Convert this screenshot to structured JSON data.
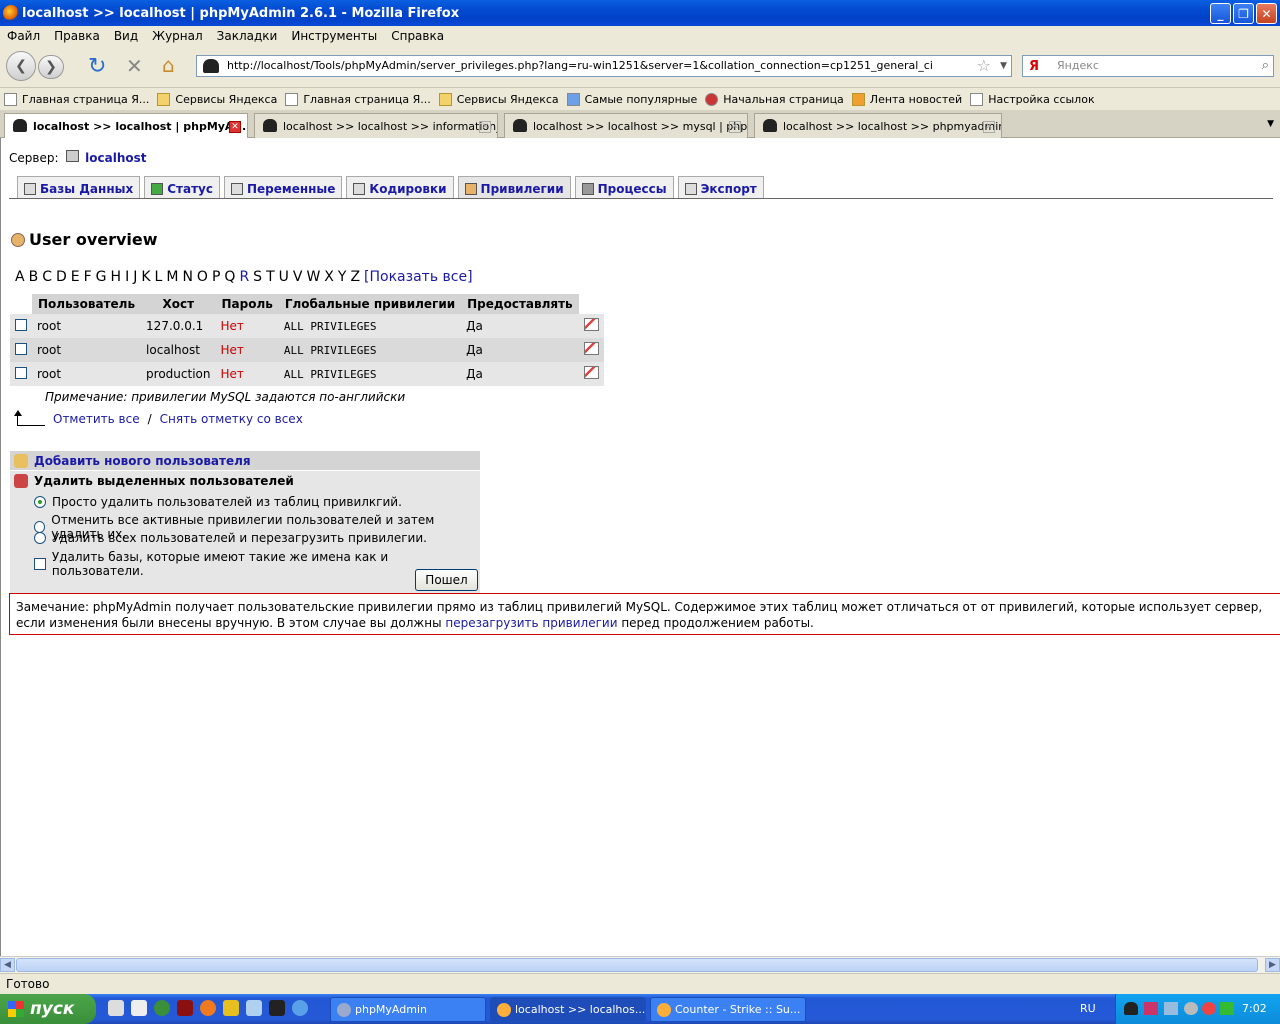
{
  "window": {
    "title": "localhost >> localhost | phpMyAdmin 2.6.1 - Mozilla Firefox"
  },
  "menu": [
    "Файл",
    "Правка",
    "Вид",
    "Журнал",
    "Закладки",
    "Инструменты",
    "Справка"
  ],
  "url": "http://localhost/Tools/phpMyAdmin/server_privileges.php?lang=ru-win1251&server=1&collation_connection=cp1251_general_ci",
  "search_placeholder": "Яндекс",
  "bookmarks": [
    "Главная страница Я...",
    "Сервисы Яндекса",
    "Главная страница Я...",
    "Сервисы Яндекса",
    "Самые популярные",
    "Начальная страница",
    "Лента новостей",
    "Настройка ссылок"
  ],
  "tabs": [
    "localhost >> localhost | phpMyA...",
    "localhost >> localhost >> information_...",
    "localhost >> localhost >> mysql | php...",
    "localhost >> localhost >> phpmyadmin..."
  ],
  "server": {
    "label": "Сервер:",
    "name": "localhost"
  },
  "page_tabs": [
    "Базы Данных",
    "Статус",
    "Переменные",
    "Кодировки",
    "Привилегии",
    "Процессы",
    "Экспорт"
  ],
  "heading": "User overview",
  "letters": [
    "A",
    "B",
    "C",
    "D",
    "E",
    "F",
    "G",
    "H",
    "I",
    "J",
    "K",
    "L",
    "M",
    "N",
    "O",
    "P",
    "Q",
    "R",
    "S",
    "T",
    "U",
    "V",
    "W",
    "X",
    "Y",
    "Z"
  ],
  "show_all": "[Показать все]",
  "table": {
    "headers": [
      "Пользователь",
      "Хост",
      "Пароль",
      "Глобальные привилегии",
      "Предоставлять"
    ],
    "rows": [
      {
        "user": "root",
        "host": "127.0.0.1",
        "password": "Нет",
        "privileges": "ALL PRIVILEGES",
        "grant": "Да"
      },
      {
        "user": "root",
        "host": "localhost",
        "password": "Нет",
        "privileges": "ALL PRIVILEGES",
        "grant": "Да"
      },
      {
        "user": "root",
        "host": "production",
        "password": "Нет",
        "privileges": "ALL PRIVILEGES",
        "grant": "Да"
      }
    ]
  },
  "note": "Примечание: привилегии MySQL задаются по-английски",
  "check_all": "Отметить все",
  "separator": "/",
  "uncheck_all": "Снять отметку со всех",
  "add_user": "Добавить нового пользователя",
  "delete": {
    "title": "Удалить выделенных пользователей",
    "options": [
      "Просто удалить пользователей из таблиц привилкгий.",
      "Отменить все активные привилегии пользователей и затем удалить их.",
      "Удалить всех пользователей и перезагрузить привилегии."
    ],
    "drop_db": "Удалить базы, которые имеют такие же имена как и пользователи.",
    "go": "Пошел"
  },
  "remark": {
    "text1": "Замечание: phpMyAdmin получает пользовательские привилегии прямо из таблиц привилегий MySQL. Содержимое этих таблиц может отличаться от от привилегий, которые использует сервер, если изменения были внесены вручную. В этом случае вы должны ",
    "link": "перезагрузить привилегии",
    "text2": " перед продолжением работы."
  },
  "status": "Готово",
  "taskbar": {
    "start": "пуск",
    "tasks": [
      "phpMyAdmin",
      "localhost >> localhos...",
      "Counter - Strike :: Su..."
    ],
    "lang": "RU",
    "clock": "7:02"
  }
}
